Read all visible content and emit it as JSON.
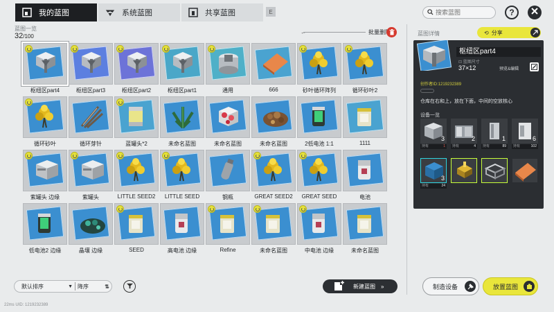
{
  "tabs": [
    {
      "label": "我的蓝图",
      "active": true
    },
    {
      "label": "系统蓝图",
      "active": false
    },
    {
      "label": "共享蓝图",
      "active": false
    }
  ],
  "search": {
    "placeholder": "搜索蓝图"
  },
  "left": {
    "title": "蓝图一览",
    "count": "32",
    "count_total": "/100",
    "batch_delete": "批量删除"
  },
  "blueprints": [
    {
      "label": "枢纽区part4",
      "kind": "hub",
      "color": "#3b8fd0",
      "badge": true,
      "selected": true
    },
    {
      "label": "枢纽区part3",
      "kind": "hub",
      "color": "#5c7fe0",
      "badge": true
    },
    {
      "label": "枢纽区part2",
      "kind": "hub",
      "color": "#6d73d8",
      "badge": true
    },
    {
      "label": "枢纽区part1",
      "kind": "hub",
      "color": "#4aa7c8",
      "badge": true
    },
    {
      "label": "通用",
      "kind": "machine",
      "color": "#4fb0c8",
      "badge": true
    },
    {
      "label": "666",
      "kind": "plate",
      "color": "#4aa3d0",
      "badge": false
    },
    {
      "label": "砂叶循环阵列",
      "kind": "plant",
      "color": "#3b8fd0",
      "badge": true
    },
    {
      "label": "循环砂叶2",
      "kind": "plant",
      "color": "#3b8fd0",
      "badge": true
    },
    {
      "label": "循环砂叶",
      "kind": "plant",
      "color": "#3b8fd0",
      "badge": true
    },
    {
      "label": "循环芽针",
      "kind": "needle",
      "color": "#3b8fd0",
      "badge": false
    },
    {
      "label": "蓝罐头*2",
      "kind": "can",
      "color": "#4aa3d0",
      "badge": true
    },
    {
      "label": "未命名蓝图",
      "kind": "leaf",
      "color": "#3b8fd0",
      "badge": false
    },
    {
      "label": "未命名蓝图",
      "kind": "crystal",
      "color": "#3b8fd0",
      "badge": false
    },
    {
      "label": "未命名蓝图",
      "kind": "ore",
      "color": "#3b8fd0",
      "badge": false
    },
    {
      "label": "2低电池 1:1",
      "kind": "battery-green",
      "color": "#3b8fd0",
      "badge": false
    },
    {
      "label": "1111",
      "kind": "cube",
      "color": "#4aa3d0",
      "badge": false
    },
    {
      "label": "紫罐头 边缘",
      "kind": "box",
      "color": "#3b8fd0",
      "badge": true
    },
    {
      "label": "紫罐头",
      "kind": "box",
      "color": "#3b8fd0",
      "badge": true
    },
    {
      "label": "LITTLE SEED2",
      "kind": "plant",
      "color": "#3b8fd0",
      "badge": true
    },
    {
      "label": "LITTLE SEED",
      "kind": "plant",
      "color": "#3b8fd0",
      "badge": true
    },
    {
      "label": "钢瓶",
      "kind": "bottle",
      "color": "#3b8fd0",
      "badge": false
    },
    {
      "label": "GREAT SEED2",
      "kind": "plant",
      "color": "#3b8fd0",
      "badge": true
    },
    {
      "label": "GREAT SEED",
      "kind": "plant",
      "color": "#3b8fd0",
      "badge": true
    },
    {
      "label": "电池",
      "kind": "battery",
      "color": "#3b8fd0",
      "badge": false
    },
    {
      "label": "低电池2 边缘",
      "kind": "battery-green",
      "color": "#3b8fd0",
      "badge": false
    },
    {
      "label": "晶壤 边缘",
      "kind": "crystal-green",
      "color": "#3b8fd0",
      "badge": false
    },
    {
      "label": "SEED",
      "kind": "cube",
      "color": "#3b8fd0",
      "badge": true
    },
    {
      "label": "高电池 边缘",
      "kind": "battery",
      "color": "#3b8fd0",
      "badge": false
    },
    {
      "label": "Refine",
      "kind": "cube",
      "color": "#3b8fd0",
      "badge": true
    },
    {
      "label": "未命名蓝图",
      "kind": "cube",
      "color": "#3b8fd0",
      "badge": true
    },
    {
      "label": "中电池 边缘",
      "kind": "battery",
      "color": "#3b8fd0",
      "badge": true
    },
    {
      "label": "未命名蓝图",
      "kind": "cube",
      "color": "#3b8fd0",
      "badge": false
    }
  ],
  "bottom": {
    "sort_label": "默认排序",
    "order_label": "降序",
    "new_blueprint": "新建蓝图",
    "status": "22ms    UID: 1219232389"
  },
  "detail": {
    "title": "蓝图详情",
    "share": "分享",
    "name": "枢纽区part4",
    "size_label": "蓝图尺寸",
    "size": "37×12",
    "preview": "预览&编辑",
    "author": "创作者ID:1219232389",
    "description": "仓库在右和上，放在下面，中间的空放核心",
    "equipment_title": "设备一览",
    "equipment": [
      {
        "count": "3",
        "owned_label": "持有",
        "owned": "1",
        "kind": "machine-a"
      },
      {
        "count": "2",
        "owned_label": "持有",
        "owned": "4",
        "kind": "machine-b"
      },
      {
        "count": "1",
        "owned_label": "持有",
        "owned": "89",
        "kind": "machine-c"
      },
      {
        "count": "6",
        "owned_label": "持有",
        "owned": "102",
        "kind": "machine-d"
      },
      {
        "count": "3",
        "owned_label": "持有",
        "owned": "24",
        "kind": "hub"
      },
      {
        "count": "",
        "owned_label": "",
        "owned": "",
        "kind": "gold-node"
      },
      {
        "count": "",
        "owned_label": "",
        "owned": "",
        "kind": "frame"
      },
      {
        "count": "",
        "owned_label": "",
        "owned": "",
        "kind": "plate"
      }
    ],
    "craft_button": "制造设备",
    "place_button": "放置蓝图"
  },
  "colors": {
    "accent_yellow": "#e9e63b",
    "danger_red": "#d63a2f",
    "dark": "#2b2e32"
  }
}
